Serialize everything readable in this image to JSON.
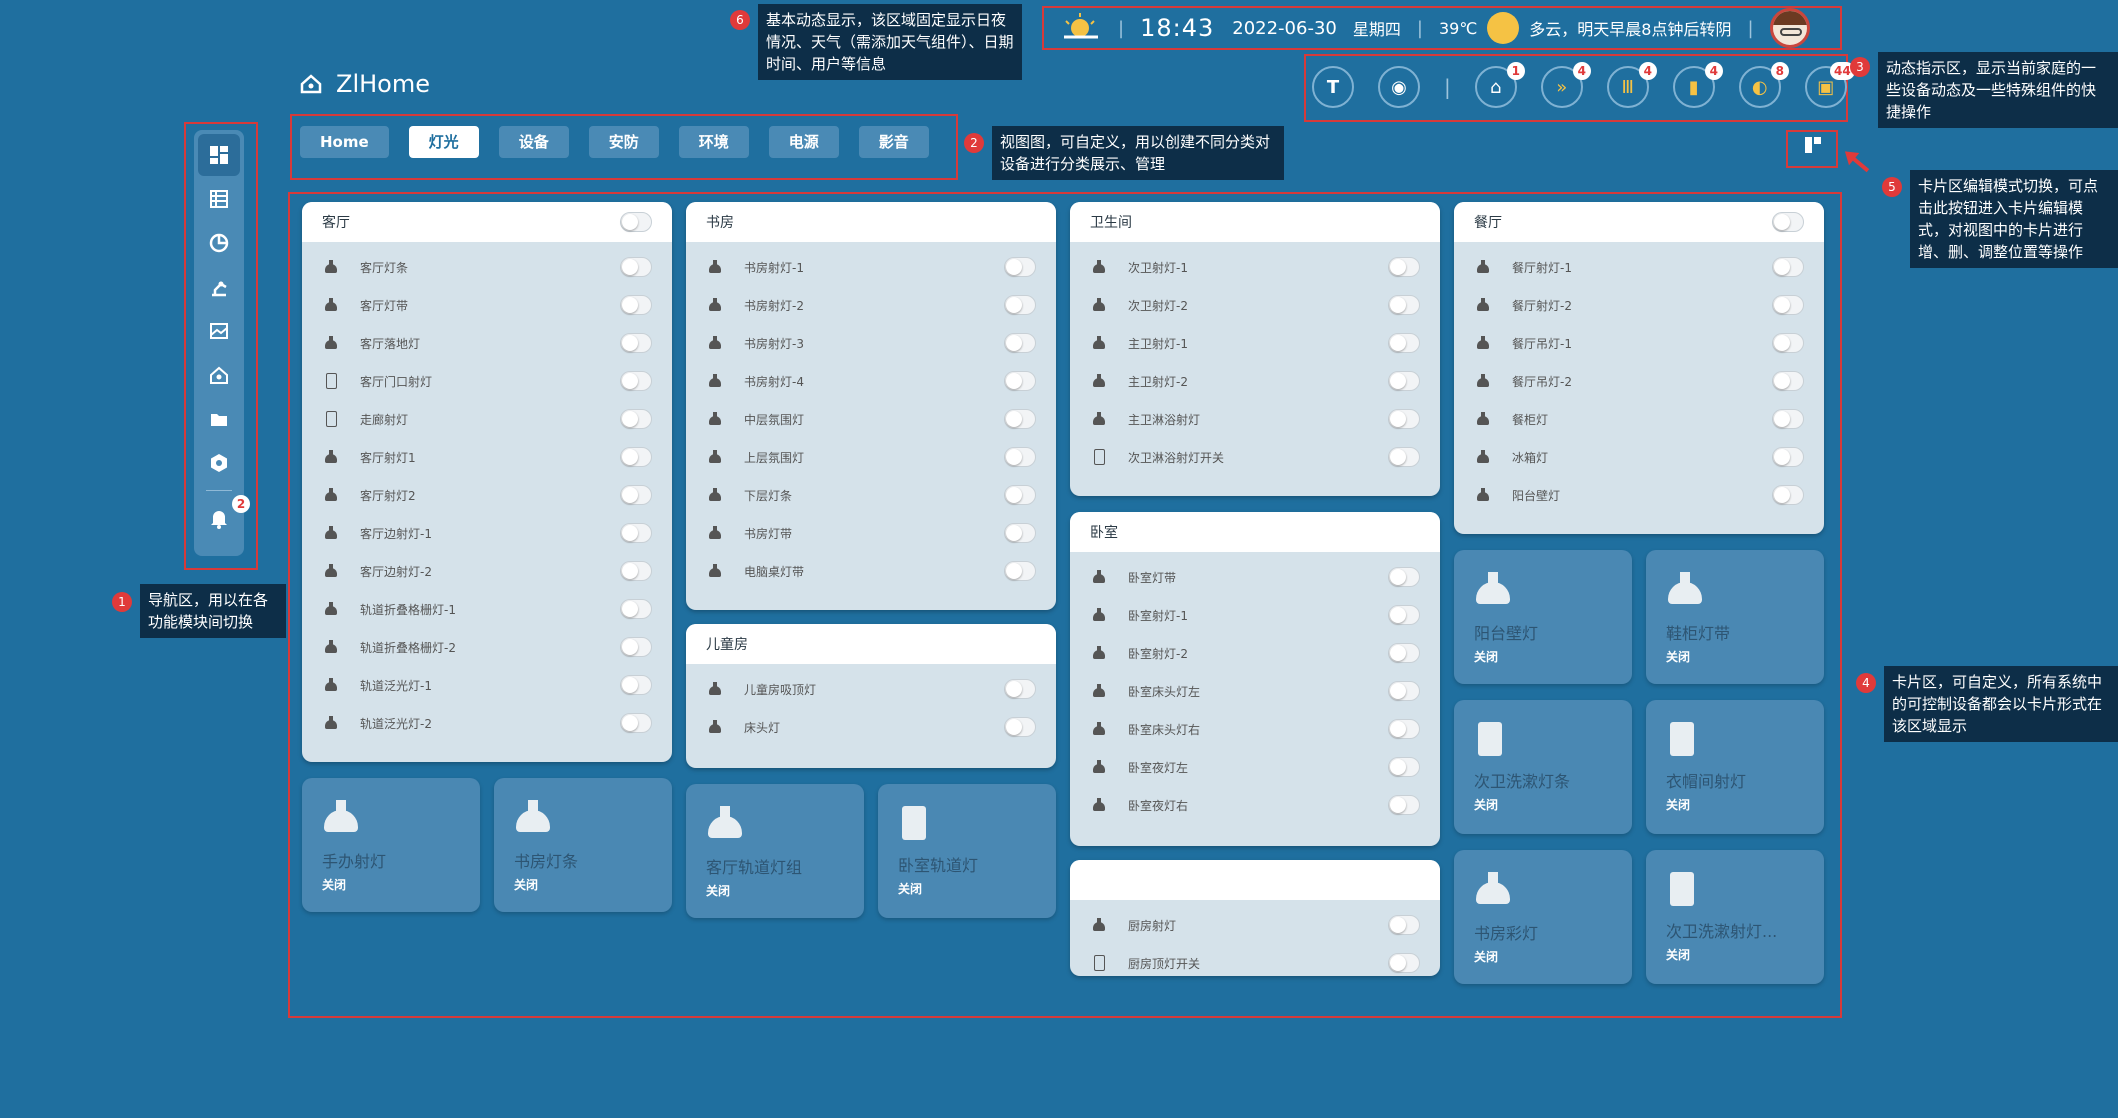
{
  "header": {
    "time": "18:43",
    "date": "2022-06-30",
    "weekday": "星期四",
    "temperature": "39℃",
    "weather_text": "多云，明天早晨8点钟后转阴",
    "brand": "ZlHome"
  },
  "tabs": [
    "Home",
    "灯光",
    "设备",
    "安防",
    "环境",
    "电源",
    "影音"
  ],
  "active_tab": "灯光",
  "sidebar": {
    "items": [
      "dashboard-icon",
      "list-icon",
      "pie-chart-icon",
      "robot-arm-icon",
      "image-chart-icon",
      "house-icon",
      "folder-icon",
      "hexagon-icon"
    ],
    "bell_badge": "2"
  },
  "dynamic_bar": {
    "items": [
      {
        "icon": "tesla-icon",
        "badge": ""
      },
      {
        "icon": "robot-vacuum-icon",
        "badge": ""
      },
      {
        "icon": "plug-icon",
        "badge": "1"
      },
      {
        "icon": "fast-forward-icon",
        "badge": "4"
      },
      {
        "icon": "heater-icon",
        "badge": "4"
      },
      {
        "icon": "door-icon",
        "badge": "4"
      },
      {
        "icon": "switch-icon",
        "badge": "8"
      },
      {
        "icon": "socket-icon",
        "badge": "44"
      }
    ]
  },
  "cards": {
    "livingroom": {
      "title": "客厅",
      "rows": [
        {
          "icon": "lamp",
          "label": "客厅灯条"
        },
        {
          "icon": "lamp",
          "label": "客厅灯带"
        },
        {
          "icon": "lamp",
          "label": "客厅落地灯"
        },
        {
          "icon": "panel",
          "label": "客厅门口射灯"
        },
        {
          "icon": "panel",
          "label": "走廊射灯"
        },
        {
          "icon": "lamp",
          "label": "客厅射灯1"
        },
        {
          "icon": "lamp",
          "label": "客厅射灯2"
        },
        {
          "icon": "lamp",
          "label": "客厅边射灯-1"
        },
        {
          "icon": "lamp",
          "label": "客厅边射灯-2"
        },
        {
          "icon": "lamp",
          "label": "轨道折叠格栅灯-1"
        },
        {
          "icon": "lamp",
          "label": "轨道折叠格栅灯-2"
        },
        {
          "icon": "lamp",
          "label": "轨道泛光灯-1"
        },
        {
          "icon": "lamp",
          "label": "轨道泛光灯-2"
        }
      ]
    },
    "study": {
      "title": "书房",
      "rows": [
        {
          "icon": "lamp",
          "label": "书房射灯-1"
        },
        {
          "icon": "lamp",
          "label": "书房射灯-2"
        },
        {
          "icon": "lamp",
          "label": "书房射灯-3"
        },
        {
          "icon": "lamp",
          "label": "书房射灯-4"
        },
        {
          "icon": "lamp",
          "label": "中层氛围灯"
        },
        {
          "icon": "lamp",
          "label": "上层氛围灯"
        },
        {
          "icon": "lamp",
          "label": "下层灯条"
        },
        {
          "icon": "lamp",
          "label": "书房灯带"
        },
        {
          "icon": "lamp",
          "label": "电脑桌灯带"
        }
      ]
    },
    "kids": {
      "title": "儿童房",
      "rows": [
        {
          "icon": "lamp",
          "label": "儿童房吸顶灯"
        },
        {
          "icon": "lamp",
          "label": "床头灯"
        }
      ]
    },
    "bathroom": {
      "title": "卫生间",
      "rows": [
        {
          "icon": "lamp",
          "label": "次卫射灯-1"
        },
        {
          "icon": "lamp",
          "label": "次卫射灯-2"
        },
        {
          "icon": "lamp",
          "label": "主卫射灯-1"
        },
        {
          "icon": "lamp",
          "label": "主卫射灯-2"
        },
        {
          "icon": "lamp",
          "label": "主卫淋浴射灯"
        },
        {
          "icon": "panel",
          "label": "次卫淋浴射灯开关"
        }
      ]
    },
    "bedroom": {
      "title": "卧室",
      "rows": [
        {
          "icon": "lamp",
          "label": "卧室灯带"
        },
        {
          "icon": "lamp",
          "label": "卧室射灯-1"
        },
        {
          "icon": "lamp",
          "label": "卧室射灯-2"
        },
        {
          "icon": "lamp",
          "label": "卧室床头灯左"
        },
        {
          "icon": "lamp",
          "label": "卧室床头灯右"
        },
        {
          "icon": "lamp",
          "label": "卧室夜灯左"
        },
        {
          "icon": "lamp",
          "label": "卧室夜灯右"
        }
      ]
    },
    "kitchen": {
      "title": "",
      "rows": [
        {
          "icon": "lamp",
          "label": "厨房射灯"
        },
        {
          "icon": "panel",
          "label": "厨房顶灯开关"
        }
      ]
    },
    "dining": {
      "title": "餐厅",
      "rows": [
        {
          "icon": "lamp",
          "label": "餐厅射灯-1"
        },
        {
          "icon": "lamp",
          "label": "餐厅射灯-2"
        },
        {
          "icon": "lamp",
          "label": "餐厅吊灯-1"
        },
        {
          "icon": "lamp",
          "label": "餐厅吊灯-2"
        },
        {
          "icon": "lamp",
          "label": "餐柜灯"
        },
        {
          "icon": "lamp",
          "label": "冰箱灯"
        },
        {
          "icon": "lamp",
          "label": "阳台壁灯"
        }
      ]
    }
  },
  "tiles": {
    "t1": {
      "icon": "lamp",
      "name": "手办射灯",
      "state": "关闭"
    },
    "t2": {
      "icon": "lamp",
      "name": "书房灯条",
      "state": "关闭"
    },
    "t3": {
      "icon": "lamp-group",
      "name": "客厅轨道灯组",
      "state": "关闭"
    },
    "t4": {
      "icon": "panel",
      "name": "卧室轨道灯",
      "state": "关闭"
    },
    "t5": {
      "icon": "lamp",
      "name": "阳台壁灯",
      "state": "关闭"
    },
    "t6": {
      "icon": "lamp",
      "name": "鞋柜灯带",
      "state": "关闭"
    },
    "t7": {
      "icon": "panel",
      "name": "次卫洗漱灯条",
      "state": "关闭"
    },
    "t8": {
      "icon": "panel",
      "name": "衣帽间射灯",
      "state": "关闭"
    },
    "t9": {
      "icon": "lamp",
      "name": "书房彩灯",
      "state": "关闭"
    },
    "t10": {
      "icon": "panel",
      "name": "次卫洗漱射灯...",
      "state": "关闭"
    }
  },
  "annotations": {
    "a1": {
      "num": "1",
      "text": "导航区，用以在各功能模块间切换"
    },
    "a2": {
      "num": "2",
      "text": "视图图，可自定义，用以创建不同分类对设备进行分类展示、管理"
    },
    "a3": {
      "num": "3",
      "text": "动态指示区，显示当前家庭的一些设备动态及一些特殊组件的快捷操作"
    },
    "a4": {
      "num": "4",
      "text": "卡片区，可自定义，所有系统中的可控制设备都会以卡片形式在该区域显示"
    },
    "a5": {
      "num": "5",
      "text": "卡片区编辑模式切换，可点击此按钮进入卡片编辑模式，对视图中的卡片进行增、删、调整位置等操作"
    },
    "a6": {
      "num": "6",
      "text": "基本动态显示，该区域固定显示日夜情况、天气（需添加天气组件）、日期时间、用户等信息"
    }
  },
  "colors": {
    "background": "#1f6f9f",
    "highlight": "#d63a3a",
    "tile": "#4a88b3"
  }
}
